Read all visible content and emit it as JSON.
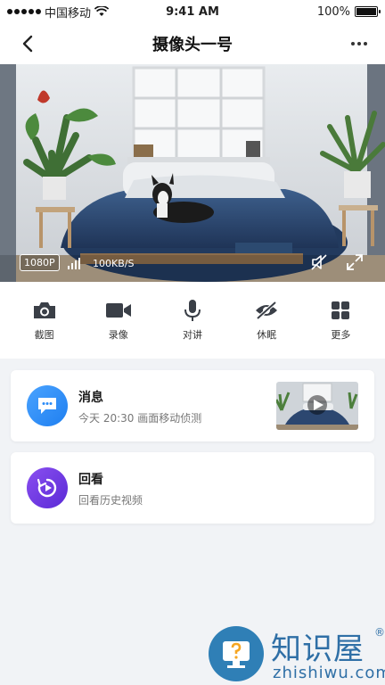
{
  "status_bar": {
    "carrier": "中国移动",
    "time": "9:41 AM",
    "battery": "100%",
    "battery_level": 1.0
  },
  "nav": {
    "title": "摄像头一号",
    "back_icon": "chevron-left-icon",
    "more_icon": "more-dots-icon"
  },
  "video": {
    "resolution": "1080P",
    "speed": "100KB/S",
    "mute_icon": "speaker-muted-icon",
    "fullscreen_icon": "fullscreen-icon"
  },
  "toolbar": [
    {
      "label": "截图",
      "icon": "camera-icon"
    },
    {
      "label": "录像",
      "icon": "video-camera-icon"
    },
    {
      "label": "对讲",
      "icon": "microphone-icon"
    },
    {
      "label": "休眠",
      "icon": "eye-off-icon"
    },
    {
      "label": "更多",
      "icon": "grid-icon"
    }
  ],
  "message_card": {
    "title": "消息",
    "subtitle": "今天 20:30 画面移动侦测",
    "icon": "chat-bubble-icon",
    "thumb_icon": "play-icon"
  },
  "playback_card": {
    "title": "回看",
    "subtitle": "回看历史视频",
    "icon": "replay-icon"
  },
  "watermark": {
    "brand": "知识屋",
    "registered": "®",
    "domain": "zhishiwu.com"
  },
  "colors": {
    "accent_blue": "#1f7ff0",
    "accent_purple": "#6a35e0",
    "background": "#f1f3f6"
  }
}
